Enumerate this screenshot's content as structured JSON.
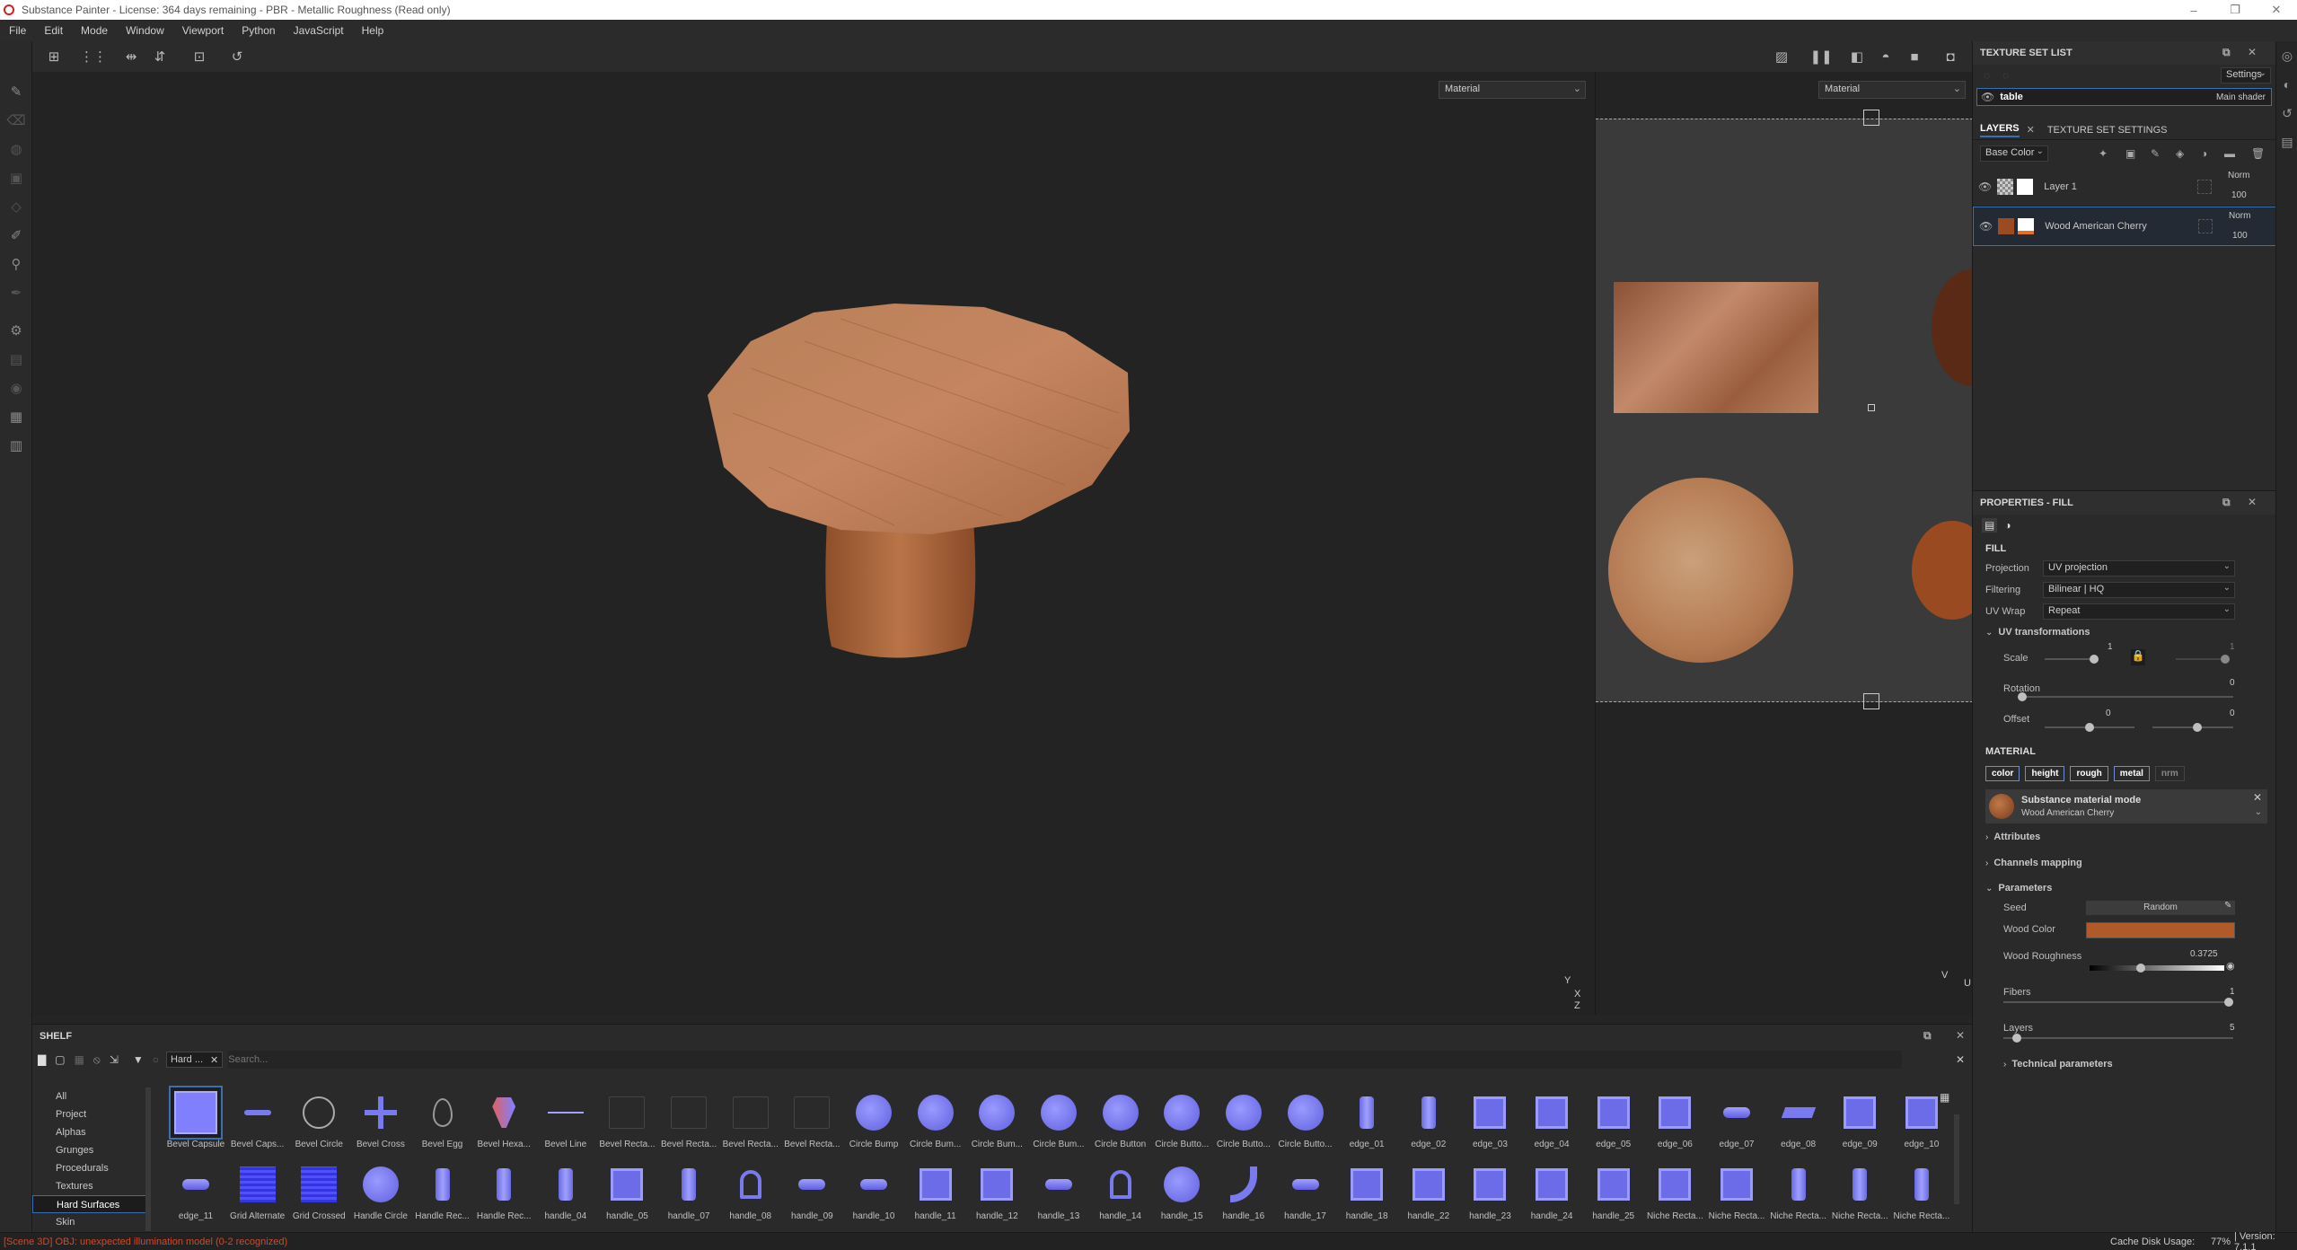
{
  "window": {
    "title": "Substance Painter - License: 364 days remaining - PBR - Metallic Roughness (Read only)",
    "controls": [
      "–",
      "❐",
      "✕"
    ]
  },
  "menubar": [
    "File",
    "Edit",
    "Mode",
    "Window",
    "Viewport",
    "Python",
    "JavaScript",
    "Help"
  ],
  "viewport": {
    "left_mode": "Material",
    "right_mode": "Material",
    "gizmo_3d": {
      "y": "Y",
      "x": "X",
      "z": "Z"
    },
    "gizmo_2d": {
      "v": "V",
      "u": "U"
    }
  },
  "texture_set_list": {
    "title": "TEXTURE SET LIST",
    "settings_label": "Settings",
    "item_name": "table",
    "item_shader": "Main shader"
  },
  "layers": {
    "tab_layers": "LAYERS",
    "tab_texture_set_settings": "TEXTURE SET SETTINGS",
    "channel": "Base Color",
    "items": [
      {
        "name": "Layer 1",
        "blend": "Norm",
        "opacity": "100"
      },
      {
        "name": "Wood American Cherry",
        "blend": "Norm",
        "opacity": "100"
      }
    ]
  },
  "properties": {
    "title": "PROPERTIES - FILL",
    "fill_heading": "FILL",
    "projection_label": "Projection",
    "projection_value": "UV projection",
    "filtering_label": "Filtering",
    "filtering_value": "Bilinear | HQ",
    "uvwrap_label": "UV Wrap",
    "uvwrap_value": "Repeat",
    "uv_transform_heading": "UV transformations",
    "scale_label": "Scale",
    "scale_value": "1",
    "scale_value_2": "1",
    "rotation_label": "Rotation",
    "rotation_value": "0",
    "offset_label": "Offset",
    "offset_value_1": "0",
    "offset_value_2": "0",
    "material_heading": "MATERIAL",
    "channel_buttons": [
      "color",
      "height",
      "rough",
      "metal",
      "nrm"
    ],
    "material_mode_title": "Substance material mode",
    "material_name": "Wood American Cherry",
    "attributes": "Attributes",
    "channels_mapping": "Channels mapping",
    "parameters": "Parameters",
    "seed_label": "Seed",
    "seed_value": "Random",
    "wood_color_label": "Wood Color",
    "wood_color": "#b05a2a",
    "wood_roughness_label": "Wood Roughness",
    "wood_roughness_value": "0.3725",
    "fibers_label": "Fibers",
    "fibers_value": "1",
    "layers_label": "Layers",
    "layers_value": "5",
    "technical_parameters": "Technical parameters"
  },
  "shelf": {
    "title": "SHELF",
    "filter_tag": "Hard ...",
    "search_placeholder": "Search...",
    "categories": [
      "All",
      "Project",
      "Alphas",
      "Grunges",
      "Procedurals",
      "Textures",
      "Hard Surfaces",
      "Skin"
    ],
    "selected_category": "Hard Surfaces",
    "row1": [
      "Bevel Capsule",
      "Bevel Caps...",
      "Bevel Circle",
      "Bevel Cross",
      "Bevel Egg",
      "Bevel Hexa...",
      "Bevel Line",
      "Bevel Recta...",
      "Bevel Recta...",
      "Bevel Recta...",
      "Bevel Recta...",
      "Circle Bump",
      "Circle Bum...",
      "Circle Bum...",
      "Circle Bum...",
      "Circle Button",
      "Circle Butto...",
      "Circle Butto...",
      "Circle Butto...",
      "edge_01",
      "edge_02",
      "edge_03",
      "edge_04",
      "edge_05",
      "edge_06",
      "edge_07",
      "edge_08",
      "edge_09",
      "edge_10"
    ],
    "row2": [
      "edge_11",
      "Grid Alternate",
      "Grid Crossed",
      "Handle Circle",
      "Handle Rec...",
      "Handle Rec...",
      "handle_04",
      "handle_05",
      "handle_07",
      "handle_08",
      "handle_09",
      "handle_10",
      "handle_11",
      "handle_12",
      "handle_13",
      "handle_14",
      "handle_15",
      "handle_16",
      "handle_17",
      "handle_18",
      "handle_22",
      "handle_23",
      "handle_24",
      "handle_25",
      "Niche Recta...",
      "Niche Recta...",
      "Niche Recta...",
      "Niche Recta...",
      "Niche Recta..."
    ]
  },
  "status": {
    "message": "[Scene 3D] OBJ: unexpected illumination model (0-2 recognized)",
    "cache": "Cache Disk Usage:",
    "cache_value": "77%",
    "version": "| Version: 7.1.1"
  },
  "colors": {
    "accent": "#3c6fb0",
    "error_text": "#d04a2a",
    "wood": "#b5703f",
    "normal_map": "#8080ff",
    "orange_mask": "#e0702a"
  }
}
